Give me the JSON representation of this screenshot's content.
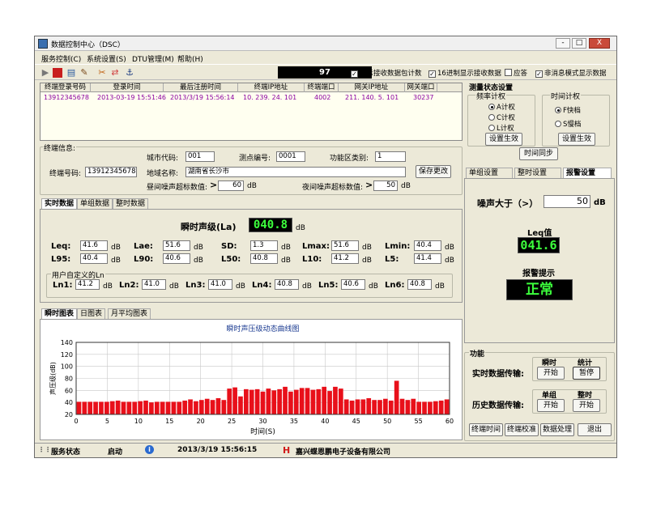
{
  "window": {
    "title": "数据控制中心（DSC）",
    "min": "-",
    "max": "□",
    "close": "X"
  },
  "menu": [
    "服务控制(C)",
    "系统设置(S)",
    "DTU管理(M)",
    "帮助(H)"
  ],
  "toolbar": {
    "icons": [
      "play-icon",
      "stop-icon",
      "settings-icon",
      "clear-icon",
      "tools-icon",
      "transfer-icon",
      "anchor-icon"
    ],
    "counter": "97",
    "checkboxes": [
      {
        "label": "显示接收数据包计数",
        "checked": true
      },
      {
        "label": "16进制显示接收数据",
        "checked": true
      },
      {
        "label": "应答",
        "checked": false
      },
      {
        "label": "非消息模式显示数据",
        "checked": true
      }
    ]
  },
  "grid": {
    "headers": [
      "终端登录号码",
      "登录时间",
      "最后注册时间",
      "终端IP地址",
      "终端端口",
      "网关IP地址",
      "网关端口"
    ],
    "rows": [
      [
        "13912345678",
        "2013-03-19 15:51:46",
        "2013/3/19 15:56:14",
        "10. 239. 24. 101",
        "4002",
        "211. 140. 5. 101",
        "30237"
      ]
    ]
  },
  "measure_status": {
    "title": "测量状态设置",
    "freq": {
      "title": "频率计权",
      "options": [
        "A计权",
        "C计权",
        "L计权"
      ],
      "selected": 0,
      "apply": "设置生效"
    },
    "time": {
      "title": "时间计权",
      "options": [
        "F快档",
        "S慢档"
      ],
      "selected": 0,
      "apply": "设置生效"
    },
    "sync": "时间同步"
  },
  "terminal": {
    "title": "终端信息:",
    "city_label": "城市代码:",
    "city": "001",
    "point_label": "测点编号:",
    "point": "0001",
    "zone_label": "功能区类别:",
    "zone": "1",
    "num_label": "终端号码:",
    "num": "13912345678",
    "area_label": "地域名称:",
    "area": "湖南省长沙市",
    "day_label": "昼间噪声超标数值:",
    "day": "60",
    "day_unit": "dB",
    "night_label": "夜间噪声超标数值:",
    "night": "50",
    "night_unit": "dB",
    "gt": ">",
    "save": "保存更改"
  },
  "data_tabs": [
    "实时数据",
    "单组数据",
    "整时数据"
  ],
  "realtime": {
    "inst_label": "瞬时声级(La)",
    "inst_value": "040.8",
    "unit": "dB",
    "stats": [
      {
        "label": "Leq:",
        "value": "41.6"
      },
      {
        "label": "Lae:",
        "value": "51.6"
      },
      {
        "label": "SD:",
        "value": "1.3"
      },
      {
        "label": "Lmax:",
        "value": "51.6"
      },
      {
        "label": "Lmin:",
        "value": "40.4"
      },
      {
        "label": "L95:",
        "value": "40.4"
      },
      {
        "label": "L90:",
        "value": "40.6"
      },
      {
        "label": "L50:",
        "value": "40.8"
      },
      {
        "label": "L10:",
        "value": "41.2"
      },
      {
        "label": "L5:",
        "value": "41.4"
      }
    ],
    "custom_title": "用户自定义的Ln",
    "custom": [
      {
        "label": "Ln1:",
        "value": "41.2"
      },
      {
        "label": "Ln2:",
        "value": "41.0"
      },
      {
        "label": "Ln3:",
        "value": "41.0"
      },
      {
        "label": "Ln4:",
        "value": "40.8"
      },
      {
        "label": "Ln5:",
        "value": "40.6"
      },
      {
        "label": "Ln6:",
        "value": "40.8"
      }
    ]
  },
  "chart_tabs": [
    "瞬时图表",
    "日图表",
    "月平均图表"
  ],
  "chart_data": {
    "type": "bar",
    "title": "瞬时声压级动态曲线图",
    "xlabel": "时间(S)",
    "ylabel": "声压级(dB)",
    "xlim": [
      0,
      60
    ],
    "ylim": [
      20,
      140
    ],
    "xticks": [
      0,
      5,
      10,
      15,
      20,
      25,
      30,
      35,
      40,
      45,
      50,
      55,
      60
    ],
    "yticks": [
      20,
      40,
      60,
      80,
      100,
      120,
      140
    ],
    "grid": true,
    "color": "#e8101a",
    "values": [
      41,
      41,
      41,
      41,
      41,
      41,
      42,
      43,
      41,
      41,
      41,
      42,
      43,
      40,
      41,
      41,
      41,
      41,
      41,
      43,
      45,
      42,
      44,
      46,
      44,
      47,
      44,
      63,
      65,
      50,
      62,
      61,
      62,
      58,
      63,
      60,
      62,
      66,
      58,
      61,
      64,
      64,
      61,
      62,
      66,
      59,
      66,
      63,
      45,
      43,
      45,
      45,
      47,
      44,
      44,
      46,
      43,
      76,
      46,
      44,
      46,
      41,
      41,
      41,
      42,
      43,
      45
    ]
  },
  "right_tabs": [
    "单组设置",
    "整时设置",
    "报警设置"
  ],
  "alarm": {
    "label": "噪声大于（>）",
    "value": "50",
    "unit": "dB",
    "leq_title": "Leq值",
    "leq_value": "041.6",
    "alert_title": "报警提示",
    "alert_value": "正常"
  },
  "functions": {
    "title": "功能",
    "realtime_label": "实时数据传输:",
    "realtime_col1": "瞬时",
    "realtime_col2": "统计",
    "realtime_btn1": "开始",
    "realtime_btn2": "暂停",
    "history_label": "历史数据传输:",
    "history_col1": "单组",
    "history_col2": "整时",
    "history_btn1": "开始",
    "history_btn2": "开始",
    "bottom": [
      "终端时间",
      "终端校准",
      "数据处理",
      "退出"
    ]
  },
  "status": {
    "service_label": "服务状态",
    "service_value": "启动",
    "datetime": "2013/3/19 15:56:15",
    "company": "嘉兴蝶恩鹏电子设备有限公司"
  }
}
